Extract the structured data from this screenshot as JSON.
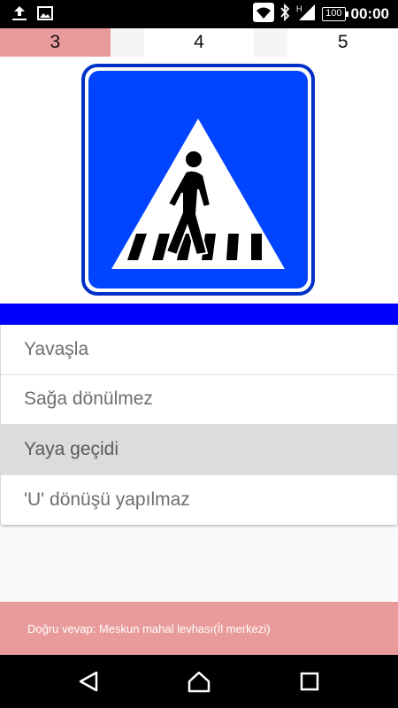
{
  "status_bar": {
    "time": "00:00",
    "battery": "100",
    "icons": [
      "upload-icon",
      "image-icon",
      "wifi-icon",
      "bluetooth-icon",
      "signal-icon",
      "battery-icon"
    ]
  },
  "tabs": [
    {
      "label": "3",
      "active": true
    },
    {
      "label": "4",
      "active": false
    },
    {
      "label": "5",
      "active": false
    }
  ],
  "sign": {
    "icon": "pedestrian-crossing-sign",
    "colors": {
      "border": "#0033cc",
      "fill": "#0044ff",
      "triangle": "#ffffff",
      "figure": "#000000"
    }
  },
  "options": [
    {
      "label": "Yavaşla",
      "selected": false
    },
    {
      "label": "Sağa dönülmez",
      "selected": false
    },
    {
      "label": "Yaya geçidi",
      "selected": true
    },
    {
      "label": "'U' dönüşü yapılmaz",
      "selected": false
    }
  ],
  "answer": {
    "text": "Doğru vevap: Meskun mahal levhası(İl merkezi)"
  },
  "nav_bar": {
    "icons": [
      "back-icon",
      "home-icon",
      "recents-icon"
    ]
  },
  "colors": {
    "accent": "#e99b9b",
    "band": "#0000ff"
  }
}
